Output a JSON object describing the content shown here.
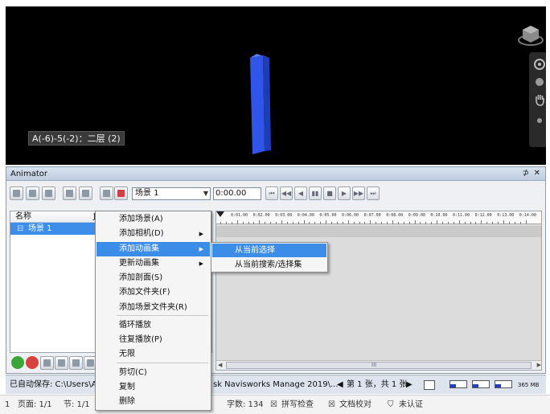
{
  "viewport": {
    "selection_label": "A(-6)-5(-2)：二层 (2)",
    "object_color": "#2f56e8",
    "icons": [
      "viewcube-icon",
      "steering-wheel-icon",
      "orbit-icon",
      "pan-hand-icon",
      "zoom-icon"
    ]
  },
  "animator": {
    "title": "Animator",
    "pin_glyph": "⊅",
    "close_glyph": "✕",
    "scene_select": "场景 1",
    "time": "0:00.00",
    "tree": {
      "header_name": "名称",
      "header_col2": "ƒ",
      "scene_row": "场景 1",
      "scene_bullet": "⊟"
    },
    "timeline": {
      "ticks": [
        "0:01.00",
        "0:02.00",
        "0:03.00",
        "0:04.00",
        "0:05.00",
        "0:06.00",
        "0:07.00",
        "0:08.00",
        "0:09.00",
        "0:10.00",
        "0:11.00",
        "0:12.00",
        "0:13.00",
        "0:14.00"
      ],
      "scroll_mark": "III"
    }
  },
  "context_menu": {
    "items": [
      {
        "label": "添加场景(A)",
        "submenu": false
      },
      {
        "label": "添加相机(D)",
        "submenu": true
      },
      {
        "label": "添加动画集",
        "submenu": true,
        "highlighted": true
      },
      {
        "label": "更新动画集",
        "submenu": true
      },
      {
        "label": "添加剖面(S)",
        "submenu": false
      },
      {
        "label": "添加文件夹(F)",
        "submenu": false
      },
      {
        "label": "添加场景文件夹(R)",
        "submenu": false
      },
      {
        "label": "循环播放",
        "submenu": false
      },
      {
        "label": "往复播放(P)",
        "submenu": false
      },
      {
        "label": "无限",
        "submenu": false
      },
      {
        "label": "剪切(C)",
        "submenu": false
      },
      {
        "label": "复制",
        "submenu": false
      },
      {
        "label": "删除",
        "submenu": false
      }
    ],
    "submenu_glyph": "▶",
    "submenu": [
      {
        "label": "从当前选择",
        "highlighted": true
      },
      {
        "label": "从当前搜索/选择集",
        "highlighted": false
      }
    ]
  },
  "status_bar": {
    "autosave": "已自动保存: C:\\Users\\Ad",
    "app": "sk Navisworks Manage 2019\\...",
    "page_info": "第 1 张，共 1 张",
    "memory": "365 MB",
    "gauge_levels": [
      0.35,
      0.35,
      0.35
    ]
  },
  "word_status": {
    "page_num": "1",
    "page": "页面: 1/1",
    "section": "节: 1/1",
    "words": "字数: 134",
    "spell": "拼写检查",
    "proof": "文档校对",
    "cert": "未认证"
  },
  "colors": {
    "accent": "#3b8de8",
    "titlebar": "#bfcde0",
    "add_button": "#3aa63a",
    "remove_button": "#d94040"
  }
}
